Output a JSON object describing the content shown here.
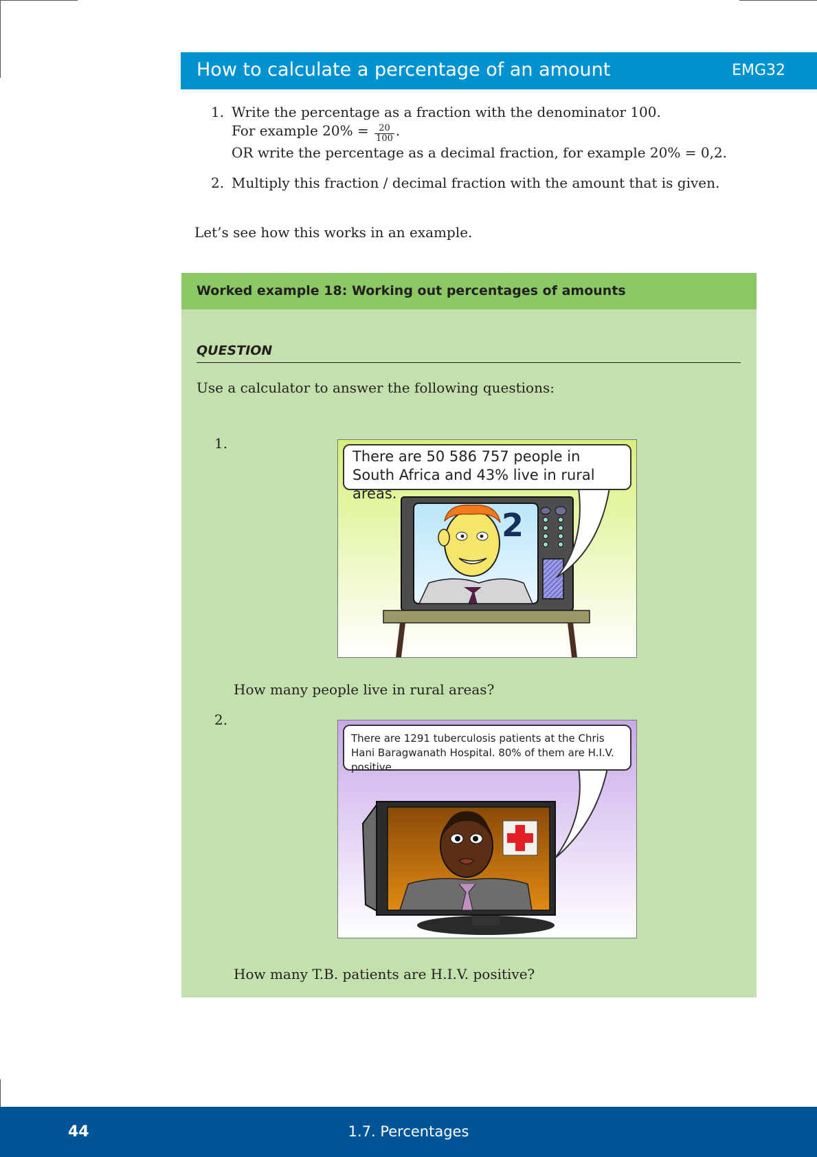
{
  "section": {
    "title": "How to calculate a percentage of an amount",
    "code": "EMG32"
  },
  "steps": [
    {
      "num": "1.",
      "line1": "Write the percentage as a fraction with the denominator 100.",
      "line2_prefix": "For example 20% =",
      "frac_num": "20",
      "frac_den": "100",
      "line2_suffix": ".",
      "line3": "OR write the percentage as a decimal fraction, for example 20% = 0,2."
    },
    {
      "num": "2.",
      "line1": "Multiply this fraction / decimal fraction with the amount that is given."
    }
  ],
  "intro": "Let’s see how this works in an example.",
  "example": {
    "header": "Worked example 18:  Working out percentages of amounts",
    "question_label": "QUESTION",
    "question_intro": "Use a calculator to answer the following questions:",
    "questions": [
      {
        "num": "1.",
        "bubble": "There are 50 586 757 people in South Africa and 43% live in rural areas.",
        "tv_channel": "2",
        "text": "How many people live in rural areas?"
      },
      {
        "num": "2.",
        "bubble": "There are 1291 tuberculosis patients at the Chris Hani Baragwanath Hospital. 80% of them are H.I.V. positive.",
        "text": "How many T.B. patients are H.I.V. positive?"
      }
    ]
  },
  "footer": {
    "page": "44",
    "chapter": "1.7.   Percentages"
  },
  "colors": {
    "section_header": "#0092d1",
    "example_header": "#8bc866",
    "example_body": "#c4e1ad",
    "footer": "#005596"
  }
}
